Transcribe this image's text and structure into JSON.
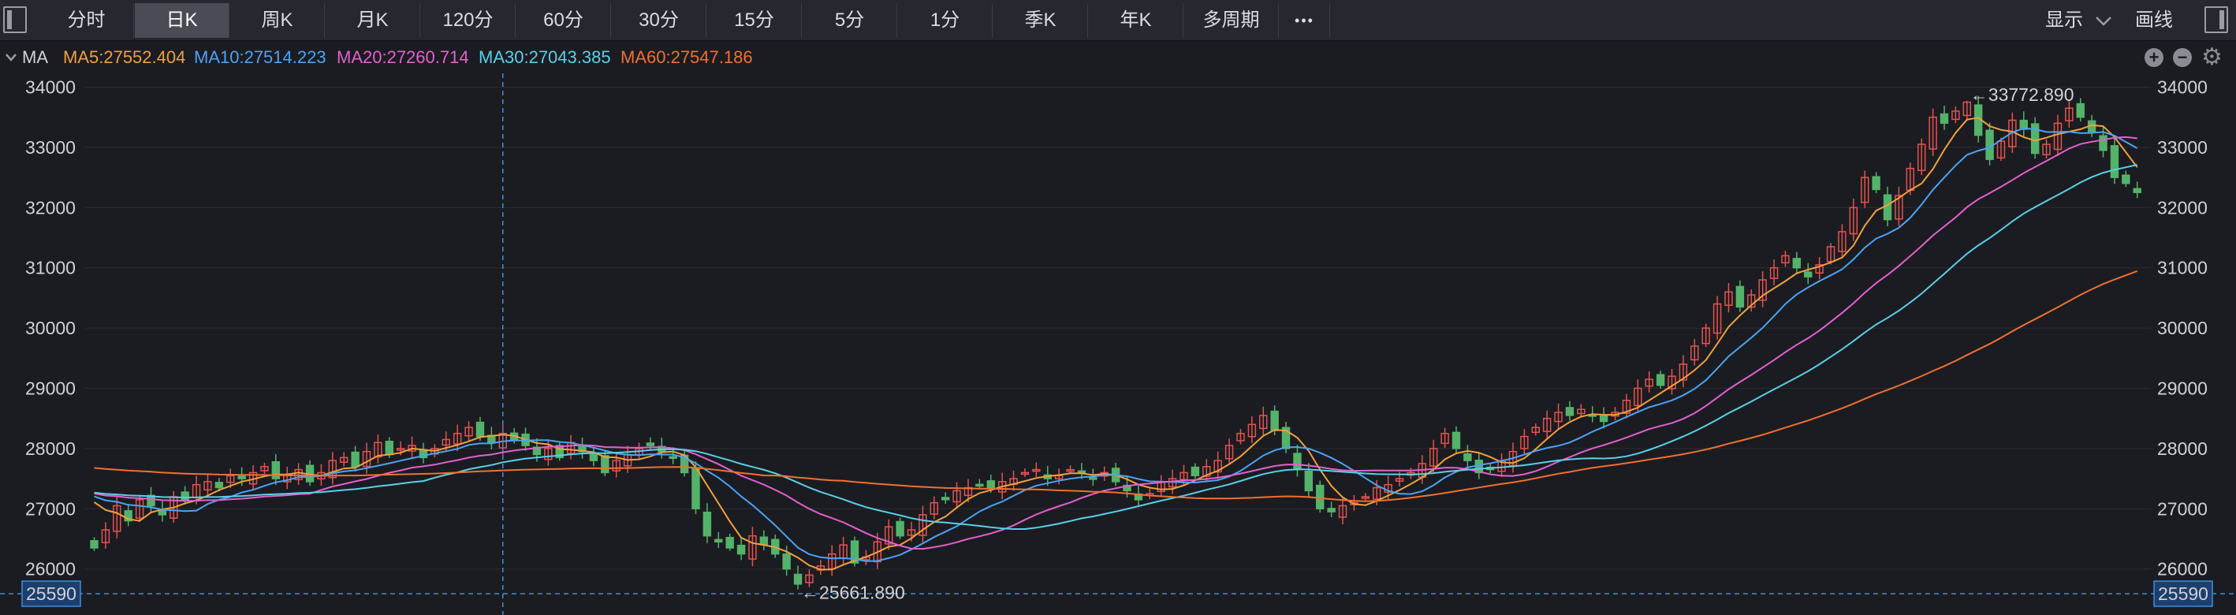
{
  "toolbar": {
    "tabs": [
      {
        "label": "分时"
      },
      {
        "label": "日K"
      },
      {
        "label": "周K"
      },
      {
        "label": "月K"
      },
      {
        "label": "120分"
      },
      {
        "label": "60分"
      },
      {
        "label": "30分"
      },
      {
        "label": "15分"
      },
      {
        "label": "5分"
      },
      {
        "label": "1分"
      },
      {
        "label": "季K"
      },
      {
        "label": "年K"
      },
      {
        "label": "多周期"
      }
    ],
    "active_tab": "日K",
    "more_label": "•••",
    "display_label": "显示",
    "draw_label": "画线"
  },
  "indicator": {
    "name": "MA",
    "items": [
      {
        "label": "MA5:27552.404",
        "color": "#f0a03c"
      },
      {
        "label": "MA10:27514.223",
        "color": "#4aa3f5"
      },
      {
        "label": "MA20:27260.714",
        "color": "#e45fd0"
      },
      {
        "label": "MA30:27043.385",
        "color": "#58d0e8"
      },
      {
        "label": "MA60:27547.186",
        "color": "#f07030"
      }
    ],
    "plus_label": "+",
    "minus_label": "−",
    "gear_label": "⚙"
  },
  "chart_data": {
    "type": "candlestick",
    "ylim": [
      25590,
      34150
    ],
    "yticks": [
      26000,
      27000,
      28000,
      29000,
      30000,
      31000,
      32000,
      33000,
      34000
    ],
    "ytick_labels": [
      "26000",
      "27000",
      "28000",
      "29000",
      "30000",
      "31000",
      "32000",
      "33000",
      "34000"
    ],
    "crosshair_value_label": "25590",
    "high_annotation": "←33772.890",
    "low_annotation": "←25661.890",
    "high_value": 33772.89,
    "low_value": 25661.89,
    "colors": {
      "up": "#e5524f",
      "down": "#54b36a"
    },
    "closes": [
      26350,
      26650,
      27050,
      26800,
      27150,
      27050,
      26900,
      27200,
      27150,
      27400,
      27450,
      27350,
      27550,
      27500,
      27600,
      27700,
      27500,
      27550,
      27650,
      27450,
      27600,
      27800,
      27850,
      27700,
      27950,
      28100,
      27900,
      28000,
      28050,
      27850,
      28000,
      28150,
      28250,
      28350,
      28200,
      28100,
      28250,
      28150,
      28050,
      27900,
      28000,
      27850,
      28100,
      27950,
      27800,
      27600,
      27800,
      27900,
      28000,
      28050,
      27950,
      27850,
      27600,
      27000,
      26550,
      26450,
      26350,
      26250,
      26550,
      26400,
      26250,
      26000,
      25750,
      25900,
      26050,
      26250,
      26400,
      26100,
      26200,
      26450,
      26700,
      26550,
      26650,
      26900,
      27100,
      27150,
      27300,
      27350,
      27400,
      27350,
      27450,
      27500,
      27600,
      27650,
      27500,
      27550,
      27650,
      27600,
      27500,
      27600,
      27450,
      27300,
      27150,
      27250,
      27450,
      27500,
      27600,
      27550,
      27700,
      27800,
      28050,
      28250,
      28400,
      28550,
      28300,
      28000,
      27650,
      27300,
      27000,
      26950,
      27050,
      27100,
      27200,
      27350,
      27400,
      27500,
      27600,
      27750,
      28000,
      28250,
      28000,
      27800,
      27600,
      27650,
      27800,
      27950,
      28200,
      28350,
      28500,
      28600,
      28550,
      28650,
      28550,
      28450,
      28600,
      28800,
      29000,
      29150,
      29050,
      29200,
      29400,
      29700,
      30000,
      30400,
      30600,
      30350,
      30550,
      30800,
      31000,
      31200,
      31000,
      30850,
      31050,
      31350,
      31600,
      32000,
      32500,
      32300,
      31800,
      32200,
      32650,
      33050,
      33500,
      33400,
      33600,
      33750,
      33200,
      32800,
      33100,
      33450,
      33300,
      32900,
      33050,
      33400,
      33650,
      33500,
      33250,
      32950,
      32500,
      32400,
      32250
    ]
  }
}
